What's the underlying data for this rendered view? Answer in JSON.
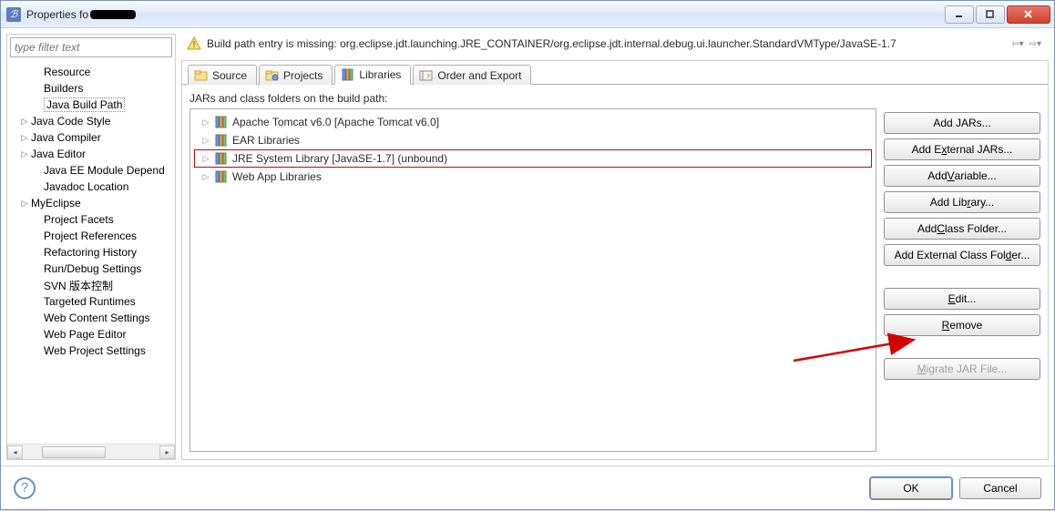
{
  "window": {
    "title_prefix": "Properties fo"
  },
  "filter": {
    "placeholder": "type filter text"
  },
  "sidebar": {
    "items": [
      {
        "label": "Resource",
        "level": 2,
        "expander": ""
      },
      {
        "label": "Builders",
        "level": 2,
        "expander": ""
      },
      {
        "label": "Java Build Path",
        "level": 2,
        "expander": "",
        "selected": true
      },
      {
        "label": "Java Code Style",
        "level": 1,
        "expander": "▷"
      },
      {
        "label": "Java Compiler",
        "level": 1,
        "expander": "▷"
      },
      {
        "label": "Java Editor",
        "level": 1,
        "expander": "▷"
      },
      {
        "label": "Java EE Module Depend",
        "level": 2,
        "expander": ""
      },
      {
        "label": "Javadoc Location",
        "level": 2,
        "expander": ""
      },
      {
        "label": "MyEclipse",
        "level": 1,
        "expander": "▷"
      },
      {
        "label": "Project Facets",
        "level": 2,
        "expander": ""
      },
      {
        "label": "Project References",
        "level": 2,
        "expander": ""
      },
      {
        "label": "Refactoring History",
        "level": 2,
        "expander": ""
      },
      {
        "label": "Run/Debug Settings",
        "level": 2,
        "expander": ""
      },
      {
        "label": "SVN 版本控制",
        "level": 2,
        "expander": ""
      },
      {
        "label": "Targeted Runtimes",
        "level": 2,
        "expander": ""
      },
      {
        "label": "Web Content Settings",
        "level": 2,
        "expander": ""
      },
      {
        "label": "Web Page Editor",
        "level": 2,
        "expander": ""
      },
      {
        "label": "Web Project Settings",
        "level": 2,
        "expander": ""
      }
    ]
  },
  "warning": {
    "text": "Build path entry is missing: org.eclipse.jdt.launching.JRE_CONTAINER/org.eclipse.jdt.internal.debug.ui.launcher.StandardVMType/JavaSE-1.7"
  },
  "tabs": [
    {
      "label": "Source",
      "icon": "folder-java-icon"
    },
    {
      "label": "Projects",
      "icon": "folder-project-icon"
    },
    {
      "label": "Libraries",
      "icon": "library-icon",
      "active": true
    },
    {
      "label": "Order and Export",
      "icon": "order-icon"
    }
  ],
  "libraries": {
    "caption": "JARs and class folders on the build path:",
    "items": [
      {
        "label": "Apache Tomcat v6.0 [Apache Tomcat v6.0]",
        "icon": "library-set-icon"
      },
      {
        "label": "EAR Libraries",
        "icon": "library-set-icon"
      },
      {
        "label": "JRE System Library [JavaSE-1.7] (unbound)",
        "icon": "library-set-icon",
        "selected": true
      },
      {
        "label": "Web App Libraries",
        "icon": "library-set-icon"
      }
    ]
  },
  "buttons": {
    "add_jars": "Add JARs...",
    "add_external_jars_pre": "Add E",
    "add_external_jars_u": "x",
    "add_external_jars_post": "ternal JARs...",
    "add_variable_pre": "Add ",
    "add_variable_u": "V",
    "add_variable_post": "ariable...",
    "add_library_pre": "Add Lib",
    "add_library_u": "r",
    "add_library_post": "ary...",
    "add_class_folder_pre": "Add ",
    "add_class_folder_u": "C",
    "add_class_folder_post": "lass Folder...",
    "add_ext_class_folder_pre": "Add External Class Fol",
    "add_ext_class_folder_u": "d",
    "add_ext_class_folder_post": "er...",
    "edit_u": "E",
    "edit_post": "dit...",
    "remove_u": "R",
    "remove_post": "emove",
    "migrate_u": "M",
    "migrate_post": "igrate JAR File..."
  },
  "footer": {
    "ok": "OK",
    "cancel": "Cancel"
  }
}
